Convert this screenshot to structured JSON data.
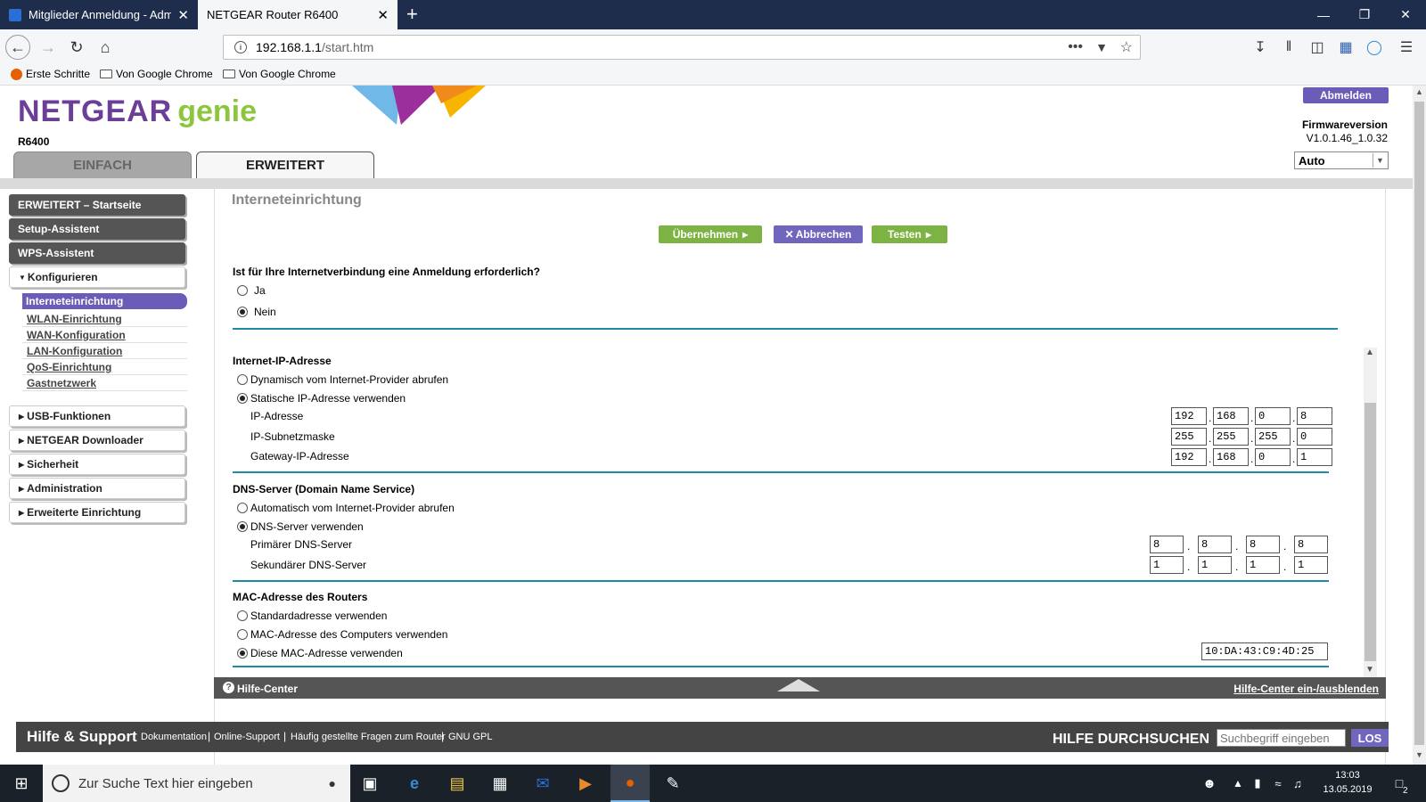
{
  "browser": {
    "tabs": [
      {
        "title": "Mitglieder Anmeldung - Admin",
        "close": "✕"
      },
      {
        "title": "NETGEAR Router R6400",
        "close": "✕"
      }
    ],
    "new_tab": "+",
    "window": {
      "minimize": "—",
      "maximize": "❐",
      "close": "✕"
    },
    "url": {
      "host": "192.168.1.1",
      "path": "/start.htm"
    },
    "bookmarks": [
      "Erste Schritte",
      "Von Google Chrome",
      "Von Google Chrome"
    ]
  },
  "header": {
    "logo_netgear": "NETGEAR",
    "logo_genie": "genie",
    "model": "R6400",
    "tabs": [
      "EINFACH",
      "ERWEITERT"
    ],
    "logout": "Abmelden",
    "firmware_label": "Firmwareversion",
    "firmware_value": "V1.0.1.46_1.0.32",
    "language": "Auto"
  },
  "sidebar": {
    "top_buttons": [
      "ERWEITERT – Startseite",
      "Setup-Assistent",
      "WPS-Assistent"
    ],
    "configure": "Konfigurieren",
    "configure_items": [
      "Interneteinrichtung",
      "WLAN-Einrichtung",
      "WAN-Konfiguration",
      "LAN-Konfiguration",
      "QoS-Einrichtung",
      "Gastnetzwerk"
    ],
    "sections": [
      "USB-Funktionen",
      "NETGEAR Downloader",
      "Sicherheit",
      "Administration",
      "Erweiterte Einrichtung"
    ]
  },
  "main": {
    "title": "Interneteinrichtung",
    "buttons": {
      "apply": "Übernehmen",
      "cancel": "Abbrechen",
      "test": "Testen"
    },
    "login_question": "Ist für Ihre Internetverbindung eine Anmeldung erforderlich?",
    "login_yes": "Ja",
    "login_no": "Nein",
    "ip_section": "Internet-IP-Adresse",
    "ip_dynamic": "Dynamisch vom Internet-Provider abrufen",
    "ip_static": "Statische IP-Adresse verwenden",
    "ip_label": "IP-Adresse",
    "subnet_label": "IP-Subnetzmaske",
    "gateway_label": "Gateway-IP-Adresse",
    "ip": [
      "192",
      "168",
      "0",
      "8"
    ],
    "subnet": [
      "255",
      "255",
      "255",
      "0"
    ],
    "gateway": [
      "192",
      "168",
      "0",
      "1"
    ],
    "dns_section": "DNS-Server (Domain Name Service)",
    "dns_auto": "Automatisch vom Internet-Provider abrufen",
    "dns_use": "DNS-Server verwenden",
    "dns1_label": "Primärer DNS-Server",
    "dns2_label": "Sekundärer DNS-Server",
    "dns1": [
      "8",
      "8",
      "8",
      "8"
    ],
    "dns2": [
      "1",
      "1",
      "1",
      "1"
    ],
    "mac_section": "MAC-Adresse des Routers",
    "mac_default": "Standardadresse verwenden",
    "mac_computer": "MAC-Adresse des Computers verwenden",
    "mac_custom": "Diese MAC-Adresse verwenden",
    "mac_value": "10:DA:43:C9:4D:25"
  },
  "help": {
    "center": "Hilfe-Center",
    "toggle": "Hilfe-Center ein-/ausblenden",
    "support_title": "Hilfe & Support",
    "links": [
      "Dokumentation",
      "Online-Support",
      "Häufig gestellte Fragen zum Router",
      "GNU GPL"
    ],
    "search_title": "HILFE DURCHSUCHEN",
    "search_placeholder": "Suchbegriff eingeben",
    "search_button": "LOS"
  },
  "taskbar": {
    "search": "Zur Suche Text hier eingeben",
    "time": "13:03",
    "date": "13.05.2019",
    "notifications": "2"
  },
  "colors": {
    "purple": "#6b5cb8",
    "green": "#7cb342",
    "divider": "#1f8aa6"
  }
}
